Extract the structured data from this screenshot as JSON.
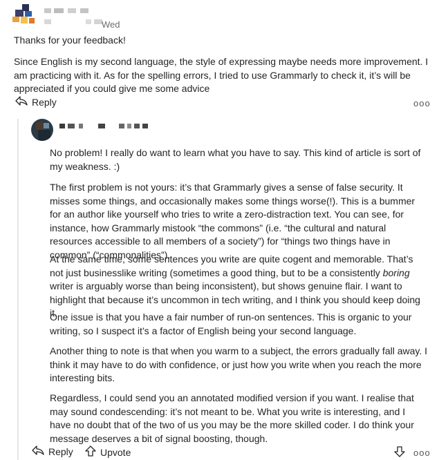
{
  "comment1": {
    "date": "Wed",
    "greeting": "Thanks for your feedback!",
    "body": "Since English is my second language, the style of expressing maybe needs more improvement. I am practicing with it. As for the spelling errors, I tried to use Grammarly to check it, it’s will be appreciated if you could give me some advice",
    "reply_label": "Reply",
    "more_label": "ooo"
  },
  "comment2": {
    "p1": "No problem! I really do want to learn what you have to say. This kind of article is sort of my weakness. :)",
    "p2": "The first problem is not yours: it’s that Grammarly gives a sense of false security. It misses some things, and occasionally makes some things worse(!). This is a bummer for an author like yourself who tries to write a zero-distraction text. You can see, for instance, how Grammarly mistook “the commons” (i.e. “the cultural and natural resources accessible to all members of a society”) for “things two things have in common” (“commonalities”).",
    "p3_before": "At the same time, some sentences you write are quite cogent and memorable. That’s not just businesslike writing (sometimes a good thing, but to be a consistently ",
    "p3_em": "boring",
    "p3_after": " writer is arguably worse than being inconsistent), but shows genuine flair. I want to highlight that because it’s uncommon in tech writing, and I think you should keep doing it.",
    "p4": "One issue is that you have a fair number of run-on sentences. This is organic to your writing, so I suspect it’s a factor of English being your second language.",
    "p5": "Another thing to note is that when you warm to a subject, the errors gradually fall away. I think it may have to do with confidence, or just how you write when you reach the more interesting bits.",
    "p6": "Regardless, I could send you an annotated modified version if you want. I realise that may sound condescending: it’s not meant to be. What you write is interesting, and I have no doubt that of the two of us you may be the more skilled coder. I do think your message deserves a bit of signal boosting, though.",
    "reply_label": "Reply",
    "upvote_label": "Upvote",
    "more_label": "ooo"
  },
  "icons": {
    "reply": "reply-arrow-icon",
    "upvote": "upvote-arrow-icon",
    "downvote": "downvote-arrow-icon",
    "more": "more-dots-icon"
  }
}
